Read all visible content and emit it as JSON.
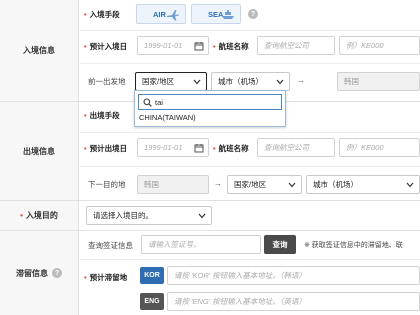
{
  "sections": {
    "entry_info": "入境信息",
    "exit_info": "出境信息",
    "entry_purpose": "入境目的",
    "stay_info": "滞留信息"
  },
  "entry": {
    "mode_label": "入境手段",
    "modes": [
      {
        "label": "AIR",
        "icon": "airplane-icon"
      },
      {
        "label": "SEA",
        "icon": "ship-icon"
      }
    ],
    "date_label": "预计入境日",
    "date_placeholder": "1999-01-01",
    "airline_label": "航班名称",
    "airline_placeholder": "查询航空公司",
    "flight_placeholder": "例）KE000",
    "departure_label": "前一出发地",
    "country_select": "国家/地区",
    "city_select": "城市（机场）",
    "country_disabled": "韩国"
  },
  "dropdown": {
    "search_value": "tai",
    "option": "CHINA(TAIWAN)"
  },
  "exit": {
    "mode_label": "出境手段",
    "date_label": "预计出境日",
    "date_placeholder": "1999-01-01",
    "airline_label": "航班名称",
    "airline_placeholder": "查询航空公司",
    "flight_placeholder": "例）KE000",
    "next_dest_label": "下一目的地",
    "country_disabled": "韩国",
    "country_select": "国家/地区",
    "city_select": "城市（机场）"
  },
  "purpose": {
    "label": "入境目的",
    "select": "请选择入境目的。"
  },
  "visa": {
    "label": "查询签证信息",
    "placeholder": "请输入签证号。",
    "button": "查询",
    "notice": "※ 获取签证信息中的滞留地、联"
  },
  "stay": {
    "label": "预计滞留地",
    "kor_tag": "KOR",
    "kor_placeholder": "请按 'KOR' 按钮输入基本地址。（韩语）",
    "eng_tag": "ENG",
    "eng_placeholder": "请按 'ENG' 按钮输入基本地址。（英语）"
  },
  "colors": {
    "required": "#e0493b",
    "accent": "#2f6db3",
    "kor_tag": "#2f6db3",
    "eng_tag": "#555555"
  }
}
